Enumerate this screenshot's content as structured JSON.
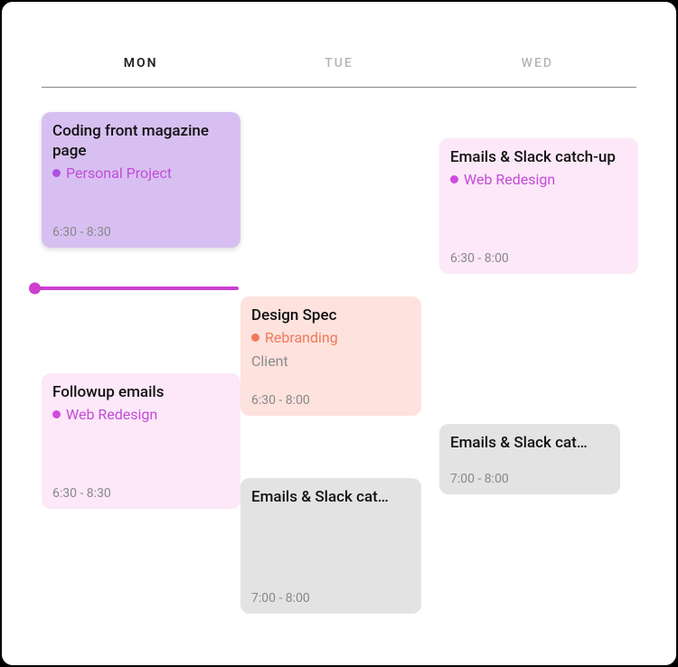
{
  "days": {
    "mon": "MON",
    "tue": "TUE",
    "wed": "WED"
  },
  "colors": {
    "purple_dot": "#b050e0",
    "magenta_dot": "#d14ae0",
    "orange_dot": "#f07a5a",
    "tag_purple_text": "#c24cd8",
    "tag_orange_text": "#f07a5a",
    "tag_grey_text": "#8a8a8a"
  },
  "events": [
    {
      "id": "ev1",
      "title": "Coding front magazine page",
      "tag_label": "Personal Project",
      "tag_color_key": "tag_purple_text",
      "dot_color_key": "purple_dot",
      "tag_sub": "",
      "time": "6:30 - 8:30"
    },
    {
      "id": "ev2",
      "title": "Emails & Slack catch-up",
      "tag_label": "Web Redesign",
      "tag_color_key": "tag_purple_text",
      "dot_color_key": "magenta_dot",
      "tag_sub": "",
      "time": "6:30 - 8:00"
    },
    {
      "id": "ev3",
      "title": "Design Spec",
      "tag_label": "Rebranding",
      "tag_color_key": "tag_orange_text",
      "dot_color_key": "orange_dot",
      "tag_sub": "Client",
      "time": "6:30 - 8:00"
    },
    {
      "id": "ev4",
      "title": "Followup emails",
      "tag_label": "Web Redesign",
      "tag_color_key": "tag_purple_text",
      "dot_color_key": "magenta_dot",
      "tag_sub": "",
      "time": "6:30 - 8:30"
    },
    {
      "id": "ev5",
      "title": "Emails & Slack cat…",
      "tag_label": "",
      "tag_color_key": "",
      "dot_color_key": "",
      "tag_sub": "",
      "time": "7:00 - 8:00"
    },
    {
      "id": "ev6",
      "title": "Emails & Slack cat…",
      "tag_label": "",
      "tag_color_key": "",
      "dot_color_key": "",
      "tag_sub": "",
      "time": "7:00 - 8:00"
    }
  ]
}
